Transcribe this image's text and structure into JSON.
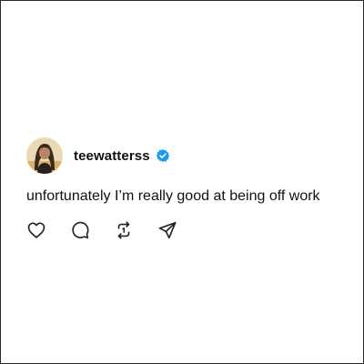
{
  "post": {
    "username": "teewatterss",
    "verified": true,
    "text": "unfortunately I’m really good at being off work"
  },
  "actions": [
    {
      "name": "like",
      "icon": "heart-icon"
    },
    {
      "name": "reply",
      "icon": "comment-icon"
    },
    {
      "name": "repost",
      "icon": "repost-icon"
    },
    {
      "name": "share",
      "icon": "send-icon"
    }
  ],
  "colors": {
    "text": "#111111",
    "verified_badge": "#1d9bf0",
    "icon_stroke": "#222222"
  }
}
